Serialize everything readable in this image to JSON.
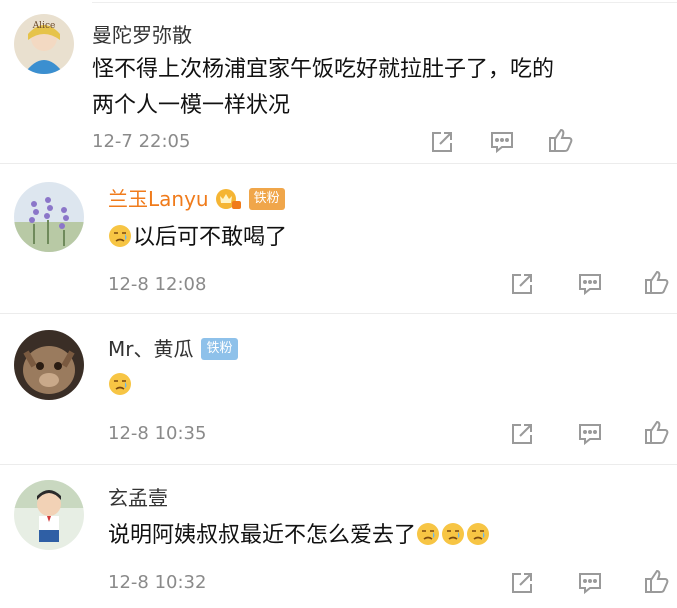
{
  "comments": [
    {
      "username": "曼陀罗弥散",
      "text_line1": "怪不得上次杨浦宜家午饭吃好就拉肚子了，吃的",
      "text_line2": "两个人一模一样状况",
      "time": "12-7 22:05",
      "avatar_text": "Alice"
    },
    {
      "username": "兰玉Lanyu",
      "badge": "铁粉",
      "text": "以后可不敢喝了",
      "time": "12-8 12:08"
    },
    {
      "username": "Mr、黄瓜",
      "badge": "铁粉",
      "text": "",
      "time": "12-8 10:35"
    },
    {
      "username": "玄孟壹",
      "text": "说明阿姨叔叔最近不怎么爱去了",
      "time": "12-8 10:32"
    }
  ],
  "colors": {
    "vip_name": "#f07b1b",
    "badge_bg": "#8ec1ea",
    "time": "#8a8a8a",
    "divider": "#ececec"
  },
  "icons": [
    "share-icon",
    "comment-icon",
    "like-icon",
    "sad-emoji-icon",
    "crown-badge-icon"
  ]
}
